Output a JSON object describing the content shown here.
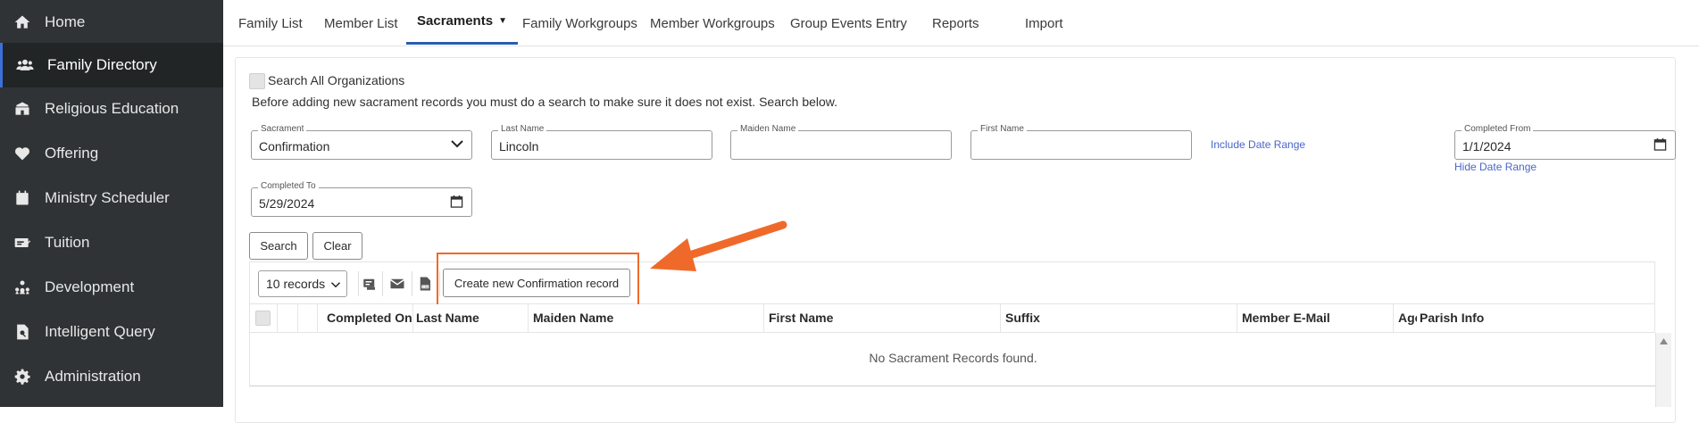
{
  "sidebar": {
    "items": [
      {
        "label": "Home",
        "icon": "home-icon"
      },
      {
        "label": "Family Directory",
        "icon": "users-icon"
      },
      {
        "label": "Religious Education",
        "icon": "school-icon"
      },
      {
        "label": "Offering",
        "icon": "heart-icon"
      },
      {
        "label": "Ministry Scheduler",
        "icon": "calendar-icon"
      },
      {
        "label": "Tuition",
        "icon": "money-icon"
      },
      {
        "label": "Development",
        "icon": "org-chart-icon"
      },
      {
        "label": "Intelligent Query",
        "icon": "document-search-icon"
      },
      {
        "label": "Administration",
        "icon": "gear-icon"
      }
    ]
  },
  "topnav": {
    "tabs": [
      {
        "label": "Family List"
      },
      {
        "label": "Member List"
      },
      {
        "label": "Sacraments",
        "caret": "▼"
      },
      {
        "label": "Family Workgroups"
      },
      {
        "label": "Member Workgroups"
      },
      {
        "label": "Group Events Entry"
      },
      {
        "label": "Reports"
      },
      {
        "label": "Import"
      }
    ]
  },
  "search_all": {
    "label": "Search All Organizations"
  },
  "notice": "Before adding new sacrament records you must do a search to make sure it does not exist. Search below.",
  "form": {
    "sacrament": {
      "label": "Sacrament",
      "value": "Confirmation"
    },
    "last_name": {
      "label": "Last Name",
      "value": "Lincoln"
    },
    "maiden_name": {
      "label": "Maiden Name",
      "value": ""
    },
    "first_name": {
      "label": "First Name",
      "value": ""
    },
    "include_date_range": "Include Date Range",
    "completed_from": {
      "label": "Completed From",
      "value": "1/1/2024"
    },
    "hide_date_range": "Hide Date Range",
    "completed_to": {
      "label": "Completed To",
      "value": "5/29/2024"
    }
  },
  "buttons": {
    "search": "Search",
    "clear": "Clear",
    "create": "Create new Confirmation record"
  },
  "toolbar": {
    "records": "10 records"
  },
  "table": {
    "columns": [
      "Completed On",
      "Last Name",
      "Maiden Name",
      "First Name",
      "Suffix",
      "Member E-Mail",
      "Age",
      "Parish Info"
    ],
    "empty_message": "No Sacrament Records found."
  },
  "colors": {
    "sidebar_bg": "#2f3335",
    "accent": "#2a5db0",
    "highlight": "#ef6a2a",
    "link": "#4a66c9"
  }
}
